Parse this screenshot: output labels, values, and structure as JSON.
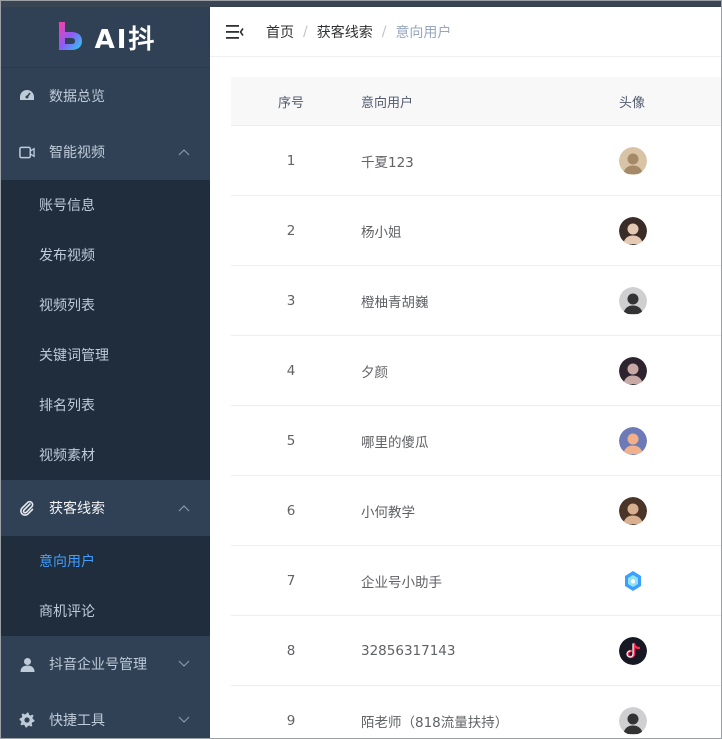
{
  "app": {
    "logo_text": "AI抖"
  },
  "sidebar": {
    "items": [
      {
        "label": "数据总览",
        "icon": "dashboard-icon"
      },
      {
        "label": "智能视频",
        "icon": "video-icon",
        "expanded": true,
        "children": [
          "账号信息",
          "发布视频",
          "视频列表",
          "关键词管理",
          "排名列表",
          "视频素材"
        ]
      },
      {
        "label": "获客线索",
        "icon": "paperclip-icon",
        "expanded": true,
        "children": [
          "意向用户",
          "商机评论"
        ],
        "active_child": "意向用户"
      },
      {
        "label": "抖音企业号管理",
        "icon": "user-icon",
        "expanded": false
      },
      {
        "label": "快捷工具",
        "icon": "gear-icon",
        "expanded": false
      }
    ]
  },
  "header": {
    "breadcrumb": [
      "首页",
      "获客线索",
      "意向用户"
    ]
  },
  "table": {
    "headers": [
      "序号",
      "意向用户",
      "头像"
    ],
    "rows": [
      {
        "index": "1",
        "user": "千夏123",
        "avatar": "avatar-photo"
      },
      {
        "index": "2",
        "user": "杨小姐",
        "avatar": "avatar-photo"
      },
      {
        "index": "3",
        "user": "橙柚青胡巍",
        "avatar": "avatar-photo"
      },
      {
        "index": "4",
        "user": "夕颜",
        "avatar": "avatar-photo"
      },
      {
        "index": "5",
        "user": "哪里的傻瓜",
        "avatar": "avatar-photo"
      },
      {
        "index": "6",
        "user": "小何教学",
        "avatar": "avatar-photo"
      },
      {
        "index": "7",
        "user": "企业号小助手",
        "avatar": "enterprise-assistant-logo"
      },
      {
        "index": "8",
        "user": "32856317143",
        "avatar": "douyin-logo"
      },
      {
        "index": "9",
        "user": "陌老师（818流量扶持）",
        "avatar": "avatar-photo"
      }
    ]
  },
  "colors": {
    "sidebar_bg": "#304156",
    "submenu_bg": "#1f2d3d",
    "active_link": "#409eff",
    "menu_text": "#bfcbd9"
  }
}
